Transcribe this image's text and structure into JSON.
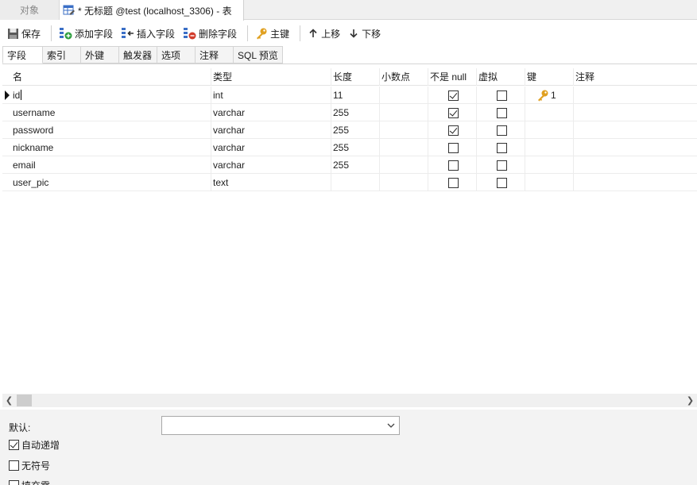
{
  "doc_tabs": {
    "objects_label": "对象",
    "active_title": "* 无标题 @test (localhost_3306) - 表"
  },
  "toolbar": {
    "save": "保存",
    "add_field": "添加字段",
    "insert_field": "插入字段",
    "delete_field": "删除字段",
    "primary_key": "主键",
    "move_up": "上移",
    "move_down": "下移"
  },
  "sub_tabs": [
    "字段",
    "索引",
    "外键",
    "触发器",
    "选项",
    "注释",
    "SQL 预览"
  ],
  "columns": [
    "名",
    "类型",
    "长度",
    "小数点",
    "不是 null",
    "虚拟",
    "键",
    "注释"
  ],
  "rows": [
    {
      "name": "id",
      "type": "int",
      "length": "11",
      "decimals": "",
      "not_null": true,
      "virtual": false,
      "key": "1",
      "comment": ""
    },
    {
      "name": "username",
      "type": "varchar",
      "length": "255",
      "decimals": "",
      "not_null": true,
      "virtual": false,
      "key": "",
      "comment": ""
    },
    {
      "name": "password",
      "type": "varchar",
      "length": "255",
      "decimals": "",
      "not_null": true,
      "virtual": false,
      "key": "",
      "comment": ""
    },
    {
      "name": "nickname",
      "type": "varchar",
      "length": "255",
      "decimals": "",
      "not_null": false,
      "virtual": false,
      "key": "",
      "comment": ""
    },
    {
      "name": "email",
      "type": "varchar",
      "length": "255",
      "decimals": "",
      "not_null": false,
      "virtual": false,
      "key": "",
      "comment": ""
    },
    {
      "name": "user_pic",
      "type": "text",
      "length": "",
      "decimals": "",
      "not_null": false,
      "virtual": false,
      "key": "",
      "comment": ""
    }
  ],
  "bottom": {
    "default_label": "默认:",
    "default_value": "",
    "options": [
      {
        "label": "自动递增",
        "checked": true
      },
      {
        "label": "无符号",
        "checked": false
      },
      {
        "label": "填充零",
        "checked": false
      }
    ]
  },
  "colors": {
    "key_gold": "#e0a020",
    "add_green": "#2e9e3e",
    "delete_red": "#d23c2c",
    "table_icon_blue": "#3b6fc6"
  }
}
